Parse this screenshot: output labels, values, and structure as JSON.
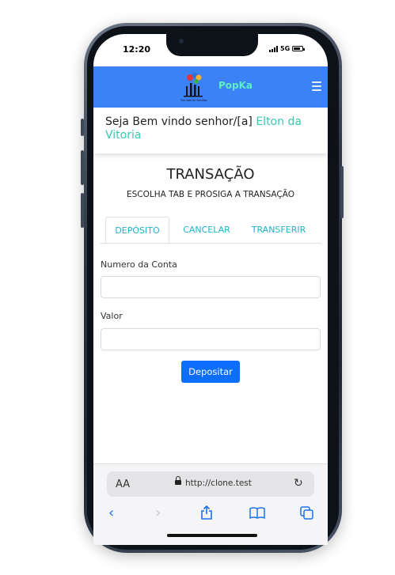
{
  "status_bar": {
    "time": "12:20",
    "network": "5G"
  },
  "navbar": {
    "brand": "PopKa",
    "logo_caption": "The Vote for Families",
    "menu_icon": "hamburger-icon"
  },
  "welcome": {
    "prefix": "Seja Bem vindo senhor/[a]",
    "name": "Elton da Vitoria"
  },
  "page": {
    "title": "TRANSAÇÃO",
    "subtitle": "ESCOLHA TAB E PROSIGA A TRANSAÇÃO"
  },
  "tabs": [
    {
      "label": "DEPÓSITO",
      "active": true
    },
    {
      "label": "CANCELAR",
      "active": false
    },
    {
      "label": "TRANSFERIR",
      "active": false
    }
  ],
  "form": {
    "account_label": "Numero da Conta",
    "account_value": "",
    "amount_label": "Valor",
    "amount_value": "",
    "submit_label": "Depositar"
  },
  "browser": {
    "text_size_icon": "AA",
    "url": "http://clone.test"
  },
  "colors": {
    "navbar": "#3b82f6",
    "brand": "#5cf0c7",
    "accent": "#20b3c8",
    "primary_button": "#0d6efd",
    "welcome_name": "#38c9b0"
  }
}
